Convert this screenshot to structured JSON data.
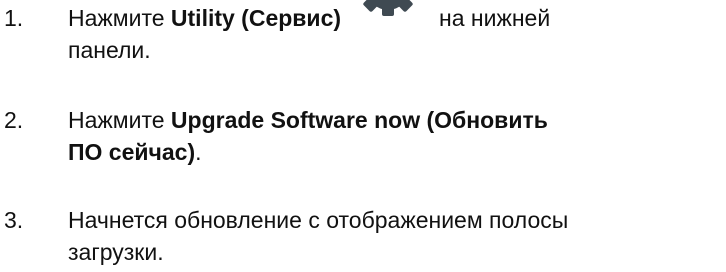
{
  "steps": [
    {
      "number": "1.",
      "line1_prefix": "Нажмите ",
      "line1_bold": "Utility (Сервис)",
      "icon": "gear-icon",
      "line1_suffix": "на нижней",
      "line2": "панели."
    },
    {
      "number": "2.",
      "line1_prefix": "Нажмите ",
      "line1_bold": "Upgrade Software now (Обновить",
      "line2_bold": "ПО сейчас)",
      "line2_suffix": "."
    },
    {
      "number": "3.",
      "line1": "Начнется обновление с отображением полосы",
      "line2": "загрузки."
    }
  ],
  "colors": {
    "text": "#111111",
    "icon": "#3f4a52"
  }
}
